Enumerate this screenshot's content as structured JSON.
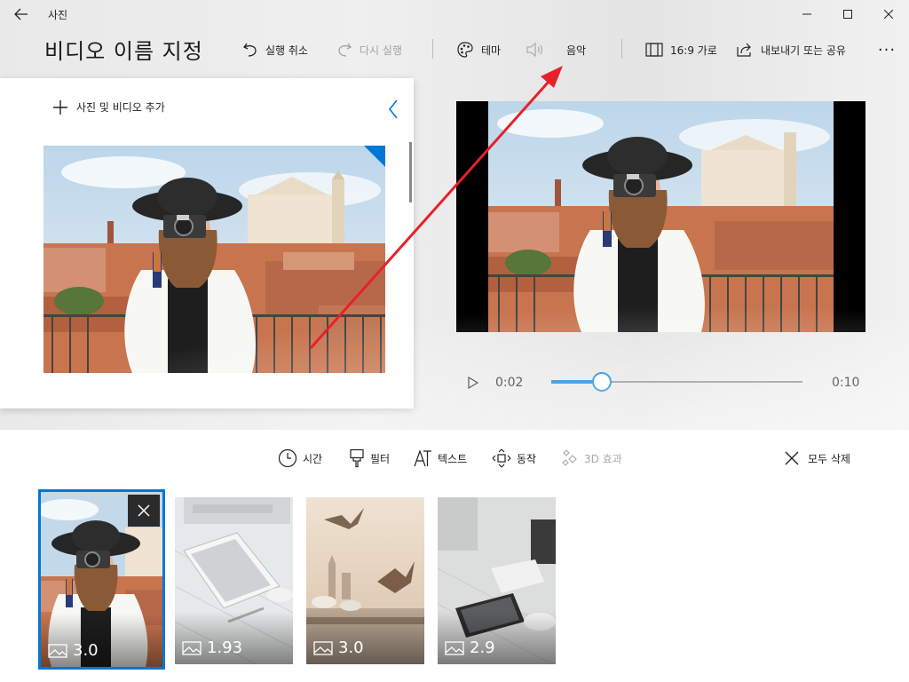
{
  "window": {
    "title": "사진",
    "back_icon": "back-arrow-icon",
    "controls": [
      "minimize-icon",
      "maximize-icon",
      "close-icon"
    ]
  },
  "page_title": "비디오 이름 지정",
  "toolbar": {
    "undo_label": "실행 취소",
    "redo_label": "다시 실행",
    "theme_label": "테마",
    "music_label": "음악",
    "aspect_label": "16:9 가로",
    "export_label": "내보내기 또는 공유",
    "more_label": "···"
  },
  "library": {
    "add_label": "사진 및 비디오 추가"
  },
  "playback": {
    "current_time": "0:02",
    "total_time": "0:10",
    "progress": 0.2
  },
  "edit_tools": {
    "duration_label": "시간",
    "filter_label": "필터",
    "text_label": "텍스트",
    "motion_label": "동작",
    "effects3d_label": "3D 효과",
    "remove_all_label": "모두 삭제"
  },
  "storyboard": {
    "cards": [
      {
        "duration": "3.0",
        "selected": true
      },
      {
        "duration": "1.93",
        "selected": false
      },
      {
        "duration": "3.0",
        "selected": false
      },
      {
        "duration": "2.9",
        "selected": false
      }
    ]
  },
  "colors": {
    "accent": "#0078d7",
    "annotation": "#e8202a"
  }
}
